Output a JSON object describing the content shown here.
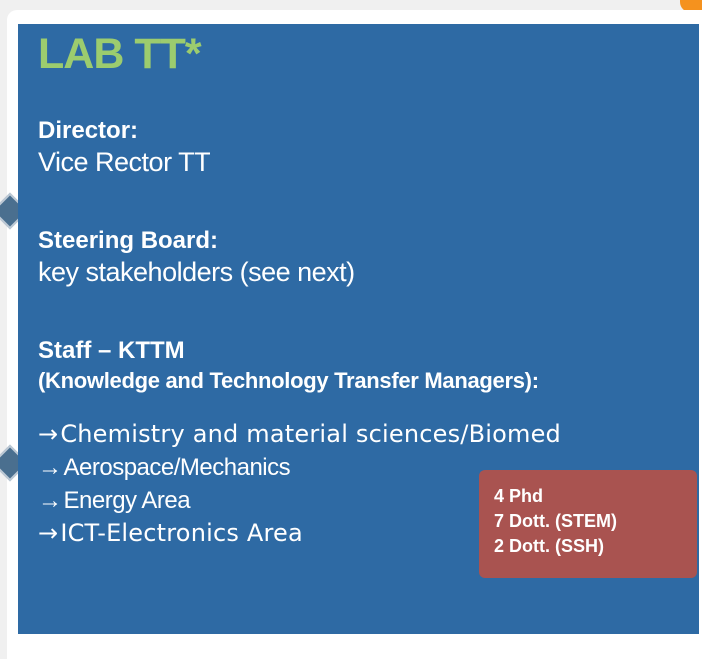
{
  "slide": {
    "title": "LAB TT*",
    "director": {
      "heading": "Director:",
      "value": "Vice Rector TT"
    },
    "steering_board": {
      "heading": "Steering Board:",
      "value": "key stakeholders (see next)"
    },
    "staff": {
      "heading": "Staff – KTTM",
      "subheading": "(Knowledge and Technology Transfer Managers):",
      "arrow_glyph": "→",
      "areas": [
        "Chemistry and material sciences/Biomed",
        "Aerospace/Mechanics",
        "Energy Area",
        "ICT-Electronics Area"
      ]
    },
    "staff_counts": [
      "4 Phd",
      "7 Dott. (STEM)",
      "2 Dott. (SSH)"
    ]
  },
  "colors": {
    "panel_background": "#2e6aa4",
    "title": "#9ccc6e",
    "badge_background": "#a95350",
    "accent_corner": "#f5921e"
  }
}
